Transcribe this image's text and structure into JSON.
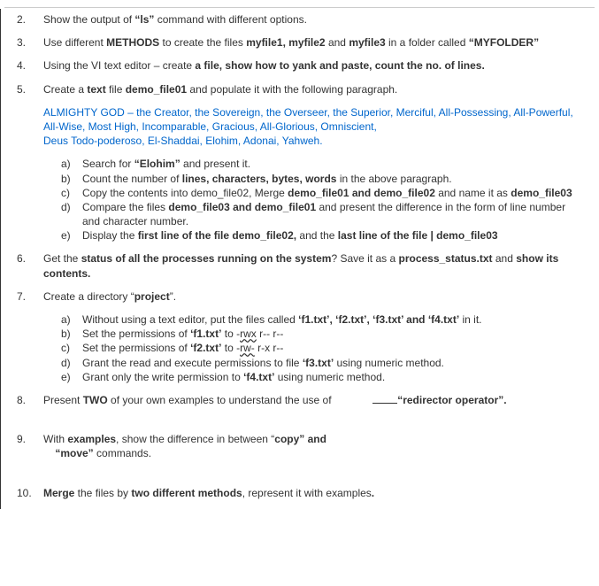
{
  "items": {
    "q2": "Show the output of <b>“ls”</b> command with different options.",
    "q3": "Use different <b>METHODS</b> to create the files <b>myfile1, myfile2</b> and <b>myfile3</b> in a folder called <b>“MYFOLDER”</b>",
    "q4": "Using the VI text editor – create <b>a file, show how to yank and paste, count the no. of lines.</b>",
    "q5": "Create a <b>text</b> file <b>demo_file01</b> and populate it with the following paragraph.",
    "q5_quote": "ALMIGHTY GOD – the Creator, the Sovereign, the Overseer, the Superior, Merciful, All-Possessing, All-Powerful, All-Wise, Most High, Incomparable, Gracious, All-Glorious, Omniscient,<br>Deus Todo-poderoso, El-Shaddai, Elohim, Adonai, Yahweh.",
    "q5a": "Search for <b>“Elohim”</b> and present it.",
    "q5b": "Count the number of <b>lines, characters, bytes, words</b> in the above paragraph.",
    "q5c": "Copy the contents into demo_file02, Merge <b>demo_file01 and demo_file02</b> and name it as <b>demo_file03</b>",
    "q5d": "Compare the files <b>demo_file03 and demo_file01</b> and present the difference in the form of line number and character number.",
    "q5e": "Display the <b>first line of the file demo_file02,</b> and the <b>last line of the file <span class='cursor'>|</span> demo_file03</b>",
    "q6": "Get the <b>status of all the processes running on the system</b>? Save it as a <b>process_status.txt</b> and <b>show its contents.</b>",
    "q7": "Create a directory “<b>project</b>”.",
    "q7a": "Without using a text editor, put the files called <b>‘f1.txt’, ‘f2.txt’, ‘f3.txt’ and ‘f4.txt’</b> in it.",
    "q7b": "Set the permissions of <b>‘f1.txt’</b> to -<span class='wavy'>rwx</span> r-- r--",
    "q7c": "Set the permissions of <b>‘f2.txt’</b> to -<span class='wavy'>rw-</span> r-x r--",
    "q7d": "Grant the read and execute permissions to file <b>‘f3.txt’</b> using numeric method.",
    "q7e": "Grant only the write permission to <b>‘f4.txt’</b> using numeric method.",
    "q8": "Present <b>TWO</b> of your own examples to understand the use of &nbsp;&nbsp;&nbsp;&nbsp;&nbsp;&nbsp;&nbsp;&nbsp;&nbsp;&nbsp;&nbsp;&nbsp;&nbsp;<span class='blank'></span><b>“redirector operator”.</b>",
    "q9": "With <b>examples</b>, show the difference in between “<b>copy” and<br>&nbsp;&nbsp;&nbsp;&nbsp;“move”</b> commands.",
    "q10": "<b>Merge</b> the files by <b>two different methods</b>, represent it with examples<b>.</b>"
  },
  "labels": {
    "n2": "2.",
    "n3": "3.",
    "n4": "4.",
    "n5": "5.",
    "n6": "6.",
    "n7": "7.",
    "n8": "8.",
    "n9": "9.",
    "n10": "10.",
    "a": "a)",
    "b": "b)",
    "c": "c)",
    "d": "d)",
    "e": "e)"
  }
}
